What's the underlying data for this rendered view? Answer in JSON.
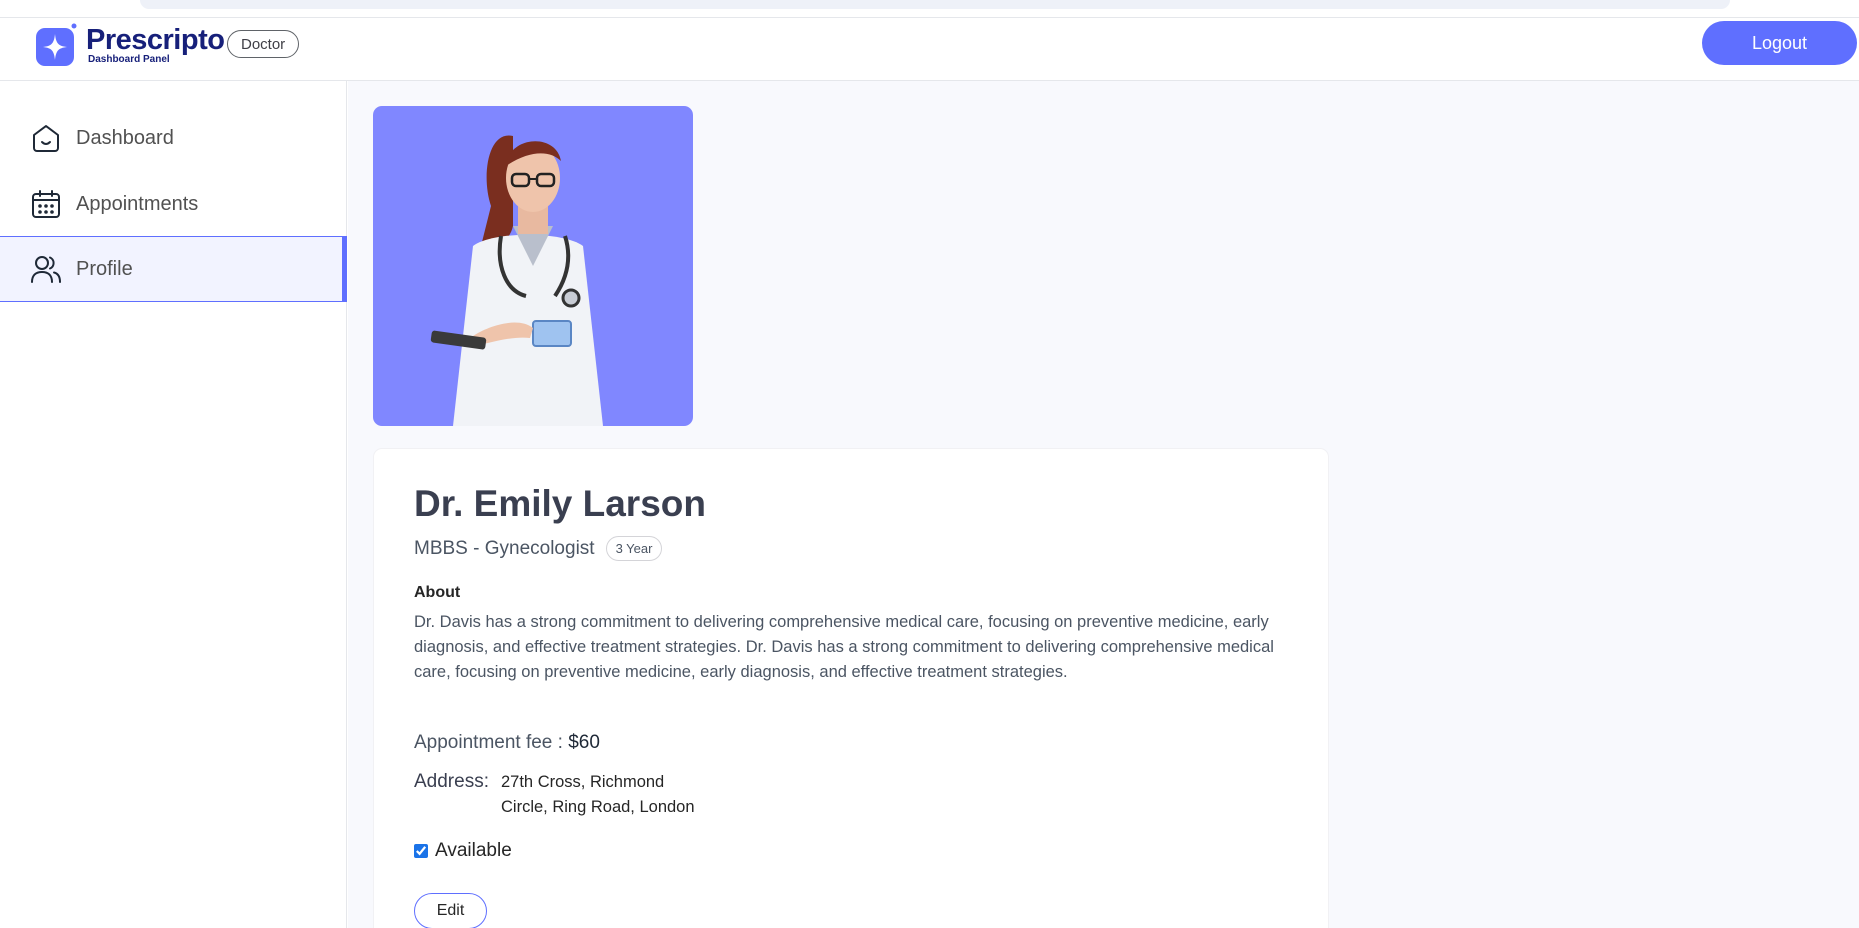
{
  "header": {
    "app_name": "Prescripto",
    "app_subtitle": "Dashboard Panel",
    "role_badge": "Doctor",
    "logout_label": "Logout"
  },
  "sidebar": {
    "items": [
      {
        "label": "Dashboard",
        "icon": "home-icon",
        "active": false
      },
      {
        "label": "Appointments",
        "icon": "calendar-icon",
        "active": false
      },
      {
        "label": "Profile",
        "icon": "people-icon",
        "active": true
      }
    ]
  },
  "profile": {
    "name": "Dr. Emily Larson",
    "degree_speciality": "MBBS - Gynecologist",
    "experience": "3 Year",
    "about_title": "About",
    "about_text": "Dr. Davis has a strong commitment to delivering comprehensive medical care, focusing on preventive medicine, early diagnosis, and effective treatment strategies. Dr. Davis has a strong commitment to delivering comprehensive medical care, focusing on preventive medicine, early diagnosis, and effective treatment strategies.",
    "fee_label": "Appointment fee :",
    "fee_value": "$60",
    "address_label": "Address:",
    "address_line1": "27th Cross, Richmond",
    "address_line2": "Circle, Ring Road, London",
    "available_label": "Available",
    "available": true,
    "edit_label": "Edit"
  },
  "colors": {
    "primary": "#5f6fff",
    "brand_text": "#17207a",
    "photo_bg": "#8087ff"
  }
}
